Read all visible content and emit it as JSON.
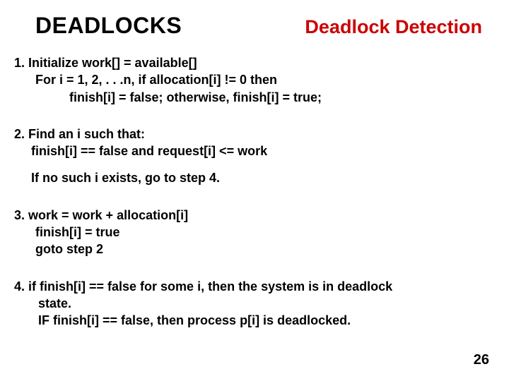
{
  "header": {
    "title_left": "DEADLOCKS",
    "title_right": "Deadlock Detection"
  },
  "steps": {
    "s1": {
      "l1": "1.  Initialize       work[] = available[]",
      "l2": "For    i = 1, 2, . . .n,   if   allocation[i] != 0   then",
      "l3": "finish[i]   =   false;   otherwise,   finish[i]  =  true;"
    },
    "s2": {
      "l1": "2.  Find an i such that:",
      "l2": "finish[i]  ==  false and request[i]  <=  work",
      "l3": "If no such i exists, go to step 4."
    },
    "s3": {
      "l1": "3.   work   =   work  +  allocation[i]",
      "l2": "finish[i]  =  true",
      "l3": "goto step 2"
    },
    "s4": {
      "l1": "4.    if  finish[i]  ==   false for some i, then the system is in deadlock",
      "l2": "state.",
      "l3": "IF finish[i] == false, then     process p[i] is deadlocked."
    }
  },
  "page_number": "26"
}
